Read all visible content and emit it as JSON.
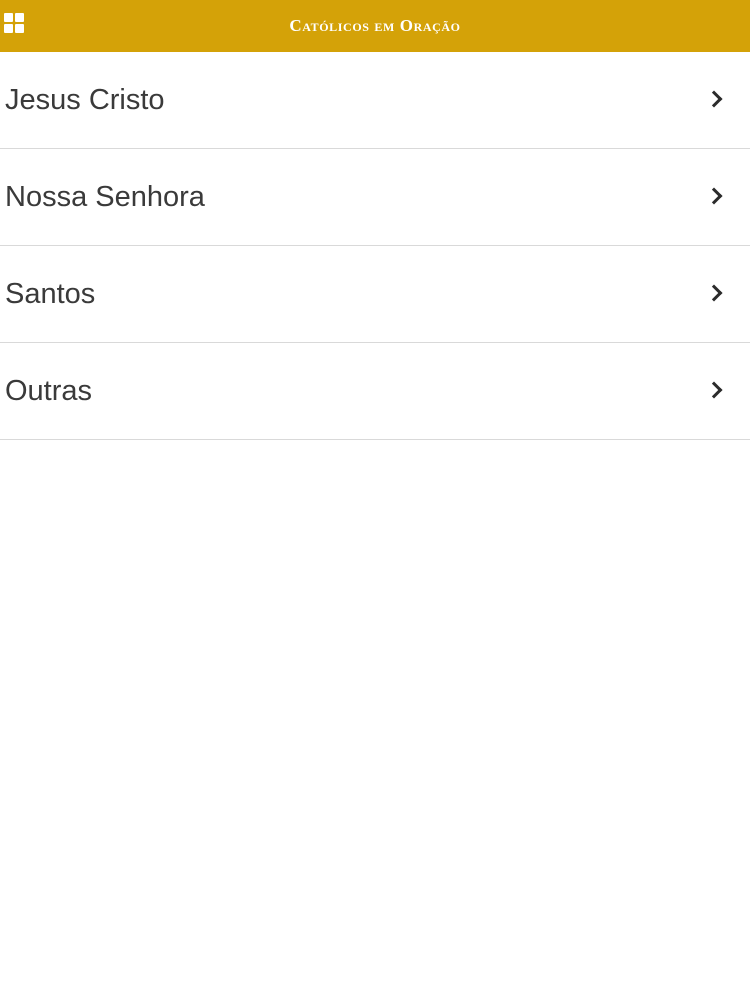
{
  "header": {
    "title": "Católicos em Oração",
    "menu_icon": "grid-icon",
    "background_color": "#d4a208"
  },
  "list": {
    "items": [
      {
        "label": "Jesus Cristo",
        "icon": "chevron-right-icon"
      },
      {
        "label": "Nossa Senhora",
        "icon": "chevron-right-icon"
      },
      {
        "label": "Santos",
        "icon": "chevron-right-icon"
      },
      {
        "label": "Outras",
        "icon": "chevron-right-icon"
      }
    ]
  }
}
